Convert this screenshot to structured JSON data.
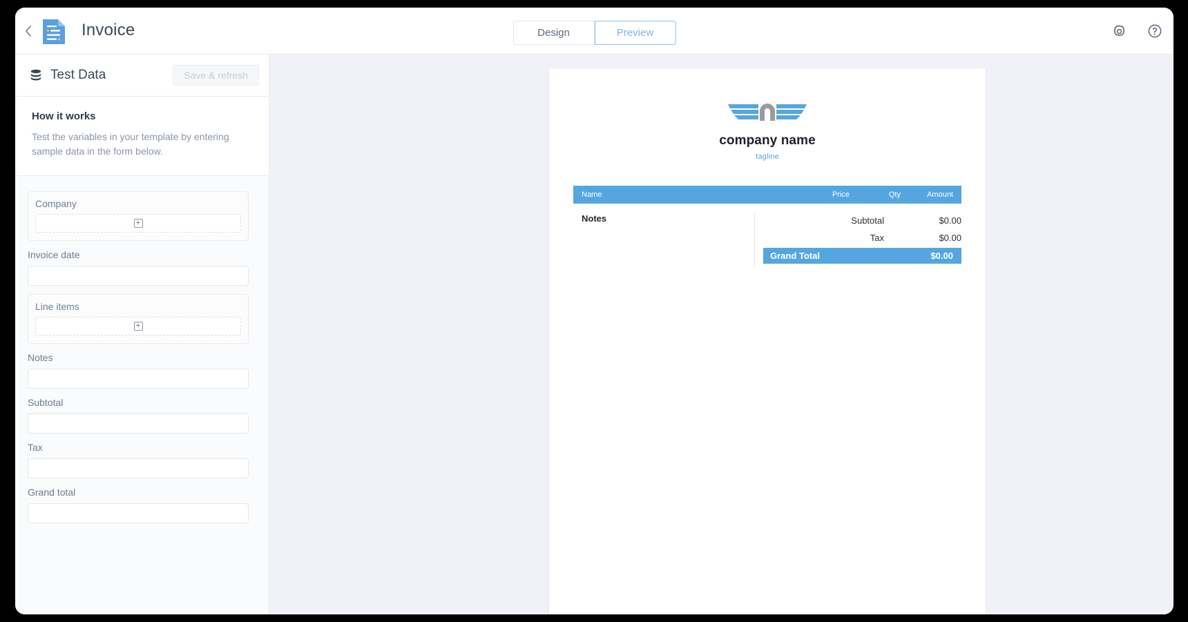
{
  "window": {
    "topbar": {
      "back_icon": "chevron-left-icon",
      "doc_icon": "document-icon",
      "title": "Invoice",
      "tabs": [
        {
          "label": "Design",
          "active": false
        },
        {
          "label": "Preview",
          "active": true
        }
      ],
      "actions": [
        {
          "icon": "gear-icon",
          "label": "Settings"
        },
        {
          "icon": "help-circle-icon",
          "label": "Help"
        }
      ]
    },
    "sidebar": {
      "icon": "database-icon",
      "title": "Test Data",
      "save_button": "Save & refresh",
      "howto": {
        "title": "How it works",
        "body": "Test the variables in your template by entering sample data in the form below."
      },
      "fields": [
        {
          "type": "group",
          "label": "Company",
          "value": "",
          "add_icon": "plus-icon"
        },
        {
          "type": "input",
          "label": "Invoice date",
          "value": "",
          "placeholder": ""
        },
        {
          "type": "group",
          "label": "Line items",
          "value": "",
          "add_icon": "plus-icon"
        },
        {
          "type": "input",
          "label": "Notes",
          "value": "",
          "placeholder": ""
        },
        {
          "type": "input",
          "label": "Subtotal",
          "value": "",
          "placeholder": ""
        },
        {
          "type": "input",
          "label": "Tax",
          "value": "",
          "placeholder": ""
        },
        {
          "type": "input",
          "label": "Grand total",
          "value": "",
          "placeholder": ""
        }
      ]
    },
    "preview": {
      "logo": {
        "mark": "winged-n-logo-icon",
        "company_name": "company name",
        "tagline": "tagline"
      },
      "table": {
        "headers": {
          "name": "Name",
          "price": "Price",
          "qty": "Qty",
          "amount": "Amount"
        },
        "rows": [],
        "notes_label": "Notes",
        "notes_value": "",
        "totals": [
          {
            "label": "Subtotal",
            "value": "$0.00",
            "highlight": false
          },
          {
            "label": "Tax",
            "value": "$0.00",
            "highlight": false
          },
          {
            "label": "Grand Total",
            "value": "$0.00",
            "highlight": true
          }
        ]
      }
    }
  },
  "colors": {
    "accent": "#55a6e0",
    "tab_active_text": "#7fb3ea",
    "canvas_bg": "#f1f2f7",
    "sidebar_bg": "#fafbfc",
    "text": "#3c4858",
    "muted": "#8b95a5"
  }
}
